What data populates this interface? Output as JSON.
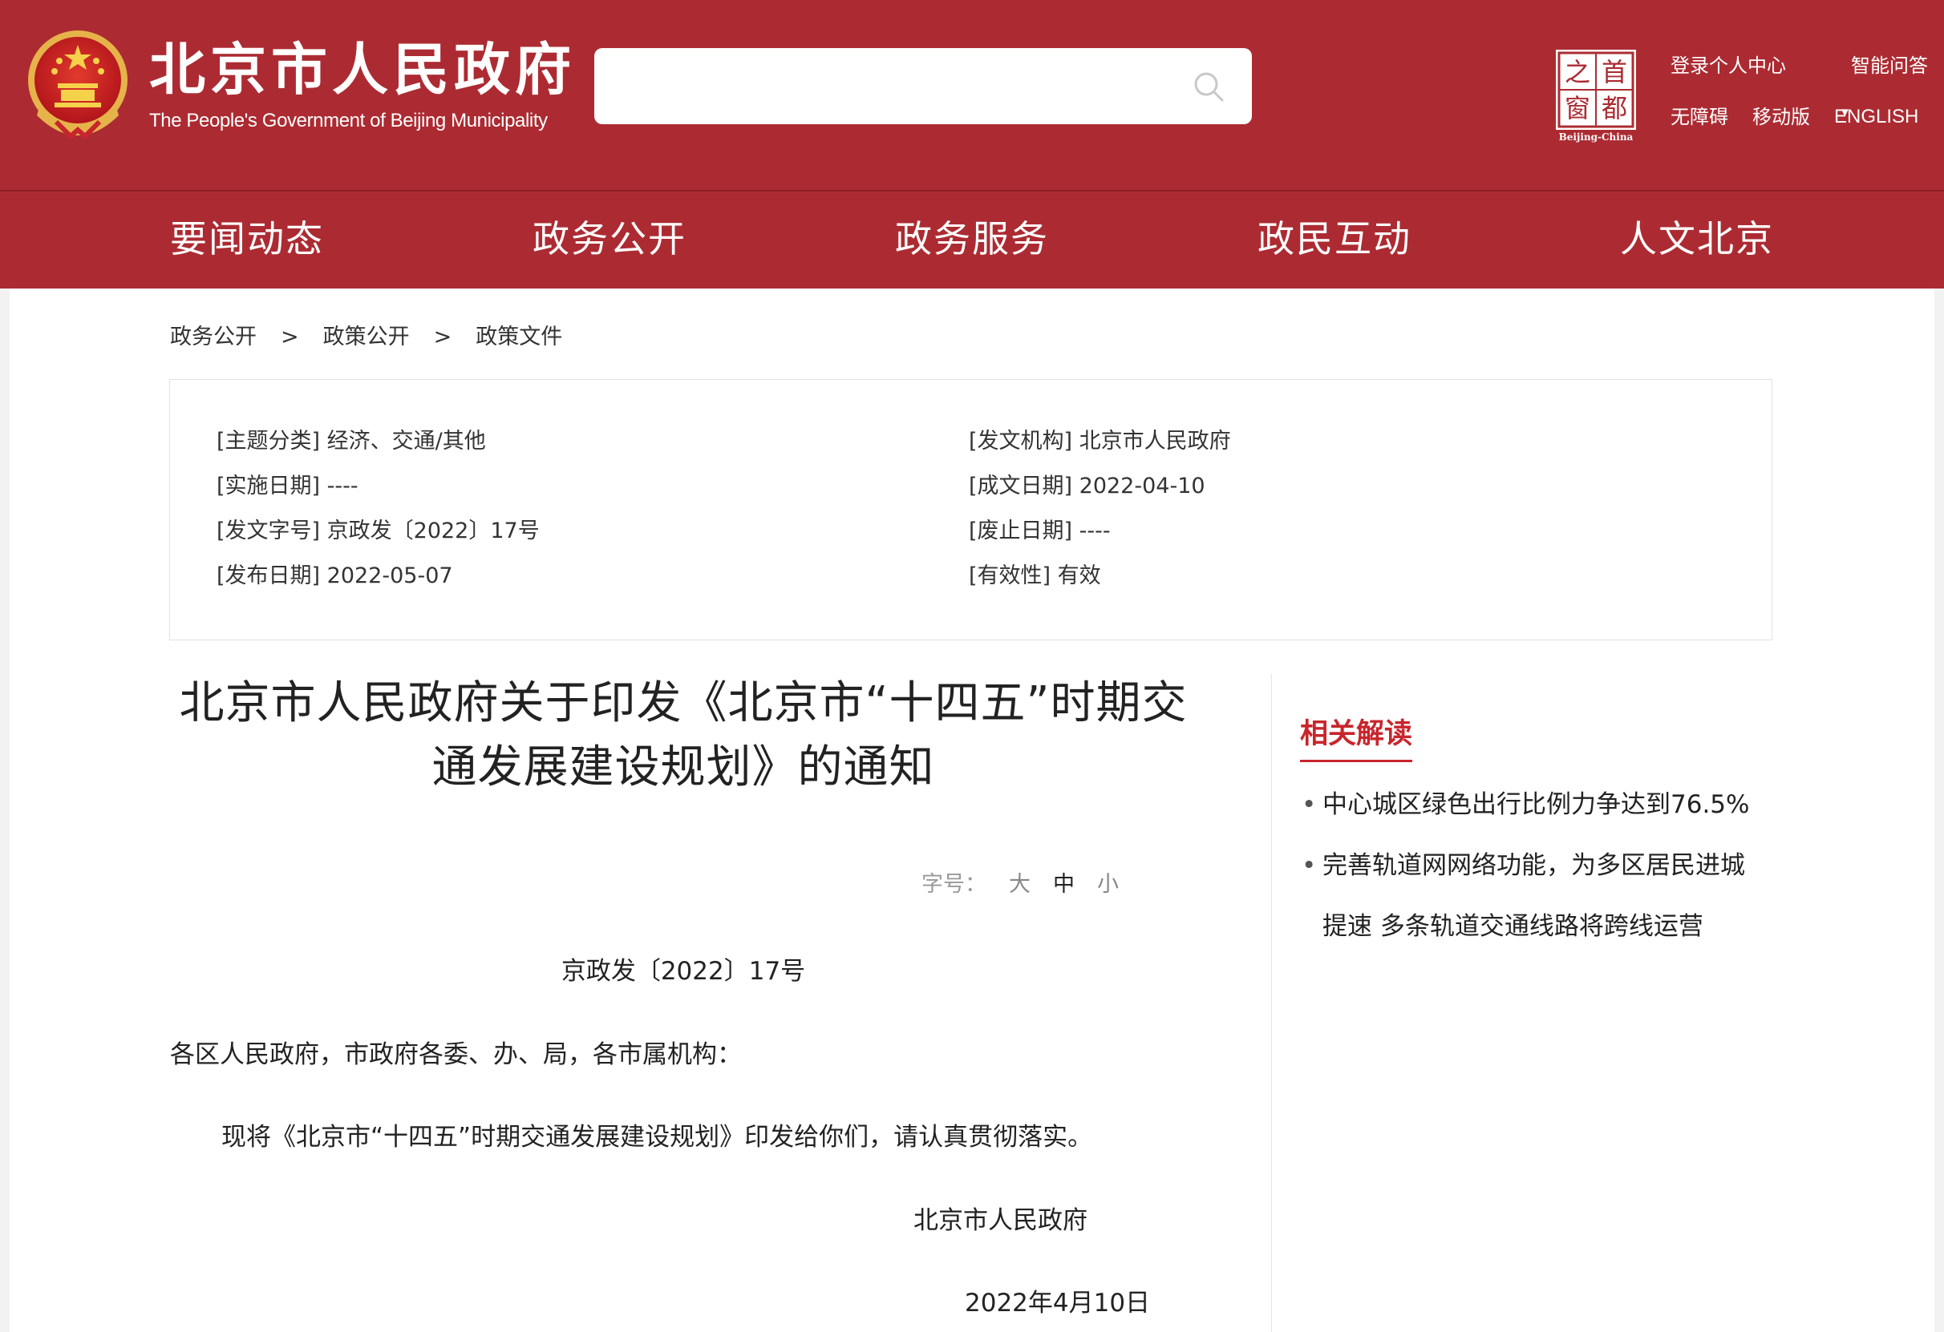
{
  "header": {
    "site_name": "北京市人民政府",
    "site_name_en": "The People's Government of Beijing Municipality",
    "search": {
      "value": "",
      "placeholder": ""
    },
    "logo_text": [
      "之",
      "首",
      "窗",
      "都"
    ],
    "logo_caption": "Beijing-China",
    "links": {
      "login": "登录个人中心",
      "ai_qa": "智能问答",
      "accessibility": "无障碍",
      "mobile": "移动版",
      "english": "ENGLISH"
    },
    "colors": {
      "header_bg": "#ac2b32",
      "accent_red": "#c8252c"
    }
  },
  "nav": [
    "要闻动态",
    "政务公开",
    "政务服务",
    "政民互动",
    "人文北京"
  ],
  "breadcrumb": [
    "政务公开",
    "政策公开",
    "政策文件"
  ],
  "breadcrumb_sep": ">",
  "meta": {
    "left": [
      "[主题分类] 经济、交通/其他",
      "[实施日期] ----",
      "[发文字号] 京政发〔2022〕17号",
      "[发布日期] 2022-05-07"
    ],
    "right": [
      "[发文机构] 北京市人民政府",
      "[成文日期] 2022-04-10",
      "[废止日期] ----",
      "[有效性] 有效"
    ]
  },
  "article": {
    "title_line1": "北京市人民政府关于印发《北京市“十四五”时期交",
    "title_line2": "通发展建设规划》的通知",
    "font_size_label": "字号：",
    "font_size_options": [
      "大",
      "中",
      "小"
    ],
    "doc_number": "京政发〔2022〕17号",
    "salutation": "各区人民政府，市政府各委、办、局，各市属机构：",
    "body": "现将《北京市“十四五”时期交通发展建设规划》印发给你们，请认真贯彻落实。",
    "signature": "北京市人民政府",
    "date": "2022年4月10日"
  },
  "sidebar": {
    "title": "相关解读",
    "items": [
      "中心城区绿色出行比例力争达到76.5%",
      "完善轨道网网络功能，为多区居民进城提速 多条轨道交通线路将跨线运营"
    ]
  }
}
